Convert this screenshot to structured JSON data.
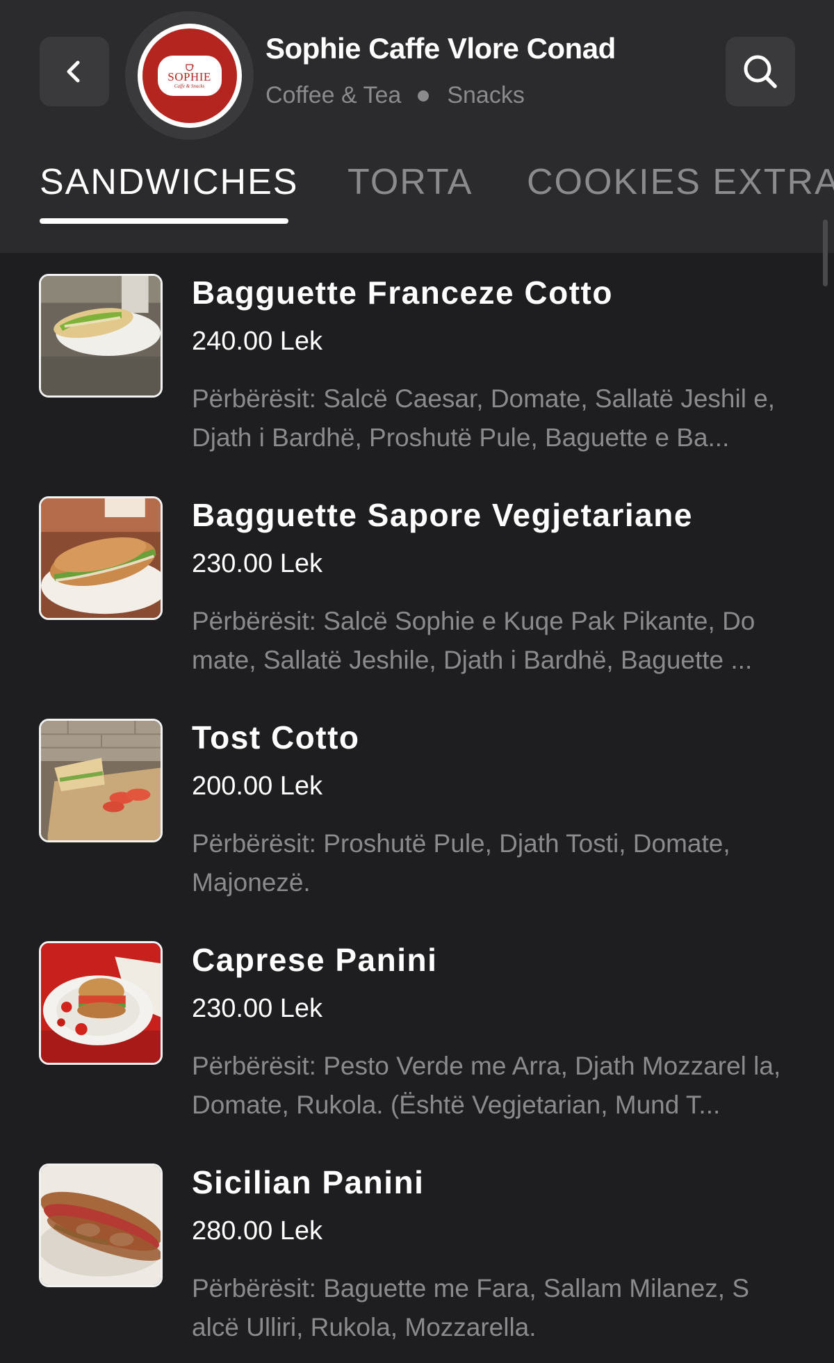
{
  "header": {
    "back_icon": "chevron-left-icon",
    "logo_text": "SOPHIE",
    "logo_subtext": "Caffe & Snacks",
    "title": "Sophie Caffe Vlore Conad",
    "category": "Coffee & Tea",
    "subcategory": "Snacks",
    "search_icon": "search-icon"
  },
  "tabs": [
    {
      "label": "SANDWICHES",
      "active": true
    },
    {
      "label": "TORTA",
      "active": false
    },
    {
      "label": "COOKIES EXTRA",
      "active": false
    }
  ],
  "items": [
    {
      "name": "Bagguette Franceze Cotto",
      "price": "240.00 Lek",
      "description": "Përbërësit: Salcë Caesar, Domate, Sallatë Jeshil e, Djath i Bardhë, Proshutë Pule, Baguette e Ba..."
    },
    {
      "name": "Bagguette Sapore Vegjetariane",
      "price": "230.00 Lek",
      "description": "Përbërësit: Salcë Sophie e Kuqe Pak Pikante, Do mate, Sallatë Jeshile, Djath i Bardhë, Baguette ..."
    },
    {
      "name": "Tost Cotto",
      "price": "200.00 Lek",
      "description": "Përbërësit: Proshutë Pule, Djath Tosti, Domate, Majonezë."
    },
    {
      "name": "Caprese Panini",
      "price": "230.00 Lek",
      "description": "Përbërësit: Pesto Verde me Arra, Djath Mozzarel la, Domate, Rukola. (Është Vegjetarian, Mund T..."
    },
    {
      "name": "Sicilian Panini",
      "price": "280.00 Lek",
      "description": "Përbërësit: Baguette me Fara, Sallam Milanez, S alcë Ulliri, Rukola, Mozzarella."
    }
  ],
  "colors": {
    "background": "#1e1e20",
    "header": "#2b2b2d",
    "muted_text": "#8b8b8e",
    "brand_red": "#b5251f"
  }
}
